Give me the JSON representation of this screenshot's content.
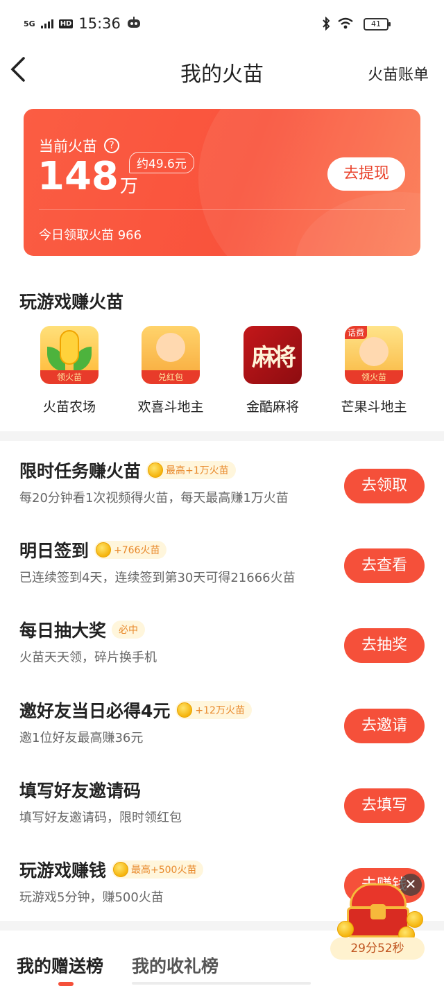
{
  "status_bar": {
    "network": "5G",
    "hd": "HD",
    "time": "15:36",
    "battery": "41"
  },
  "header": {
    "title": "我的火苗",
    "right_link": "火苗账单"
  },
  "balance": {
    "label": "当前火苗",
    "amount": "148",
    "unit": "万",
    "approx": "约49.6元",
    "withdraw": "去提现",
    "today": "今日领取火苗 966"
  },
  "games_section": {
    "title": "玩游戏赚火苗",
    "games": [
      {
        "name": "火苗农场",
        "tag": "领火苗"
      },
      {
        "name": "欢喜斗地主",
        "tag": "兑红包"
      },
      {
        "name": "金酷麻将",
        "icon_text": "麻将"
      },
      {
        "name": "芒果斗地主",
        "tag": "领火苗",
        "corner": "话费"
      }
    ]
  },
  "tasks": [
    {
      "title": "限时任务赚火苗",
      "badge": "最高+1万火苗",
      "coin": true,
      "desc": "每20分钟看1次视频得火苗，每天最高赚1万火苗",
      "button": "去领取"
    },
    {
      "title": "明日签到",
      "badge": "+766火苗",
      "coin": true,
      "desc": "已连续签到4天，连续签到第30天可得21666火苗",
      "button": "去查看"
    },
    {
      "title": "每日抽大奖",
      "badge": "必中",
      "coin": false,
      "desc": "火苗天天领，碎片换手机",
      "button": "去抽奖"
    },
    {
      "title": "邀好友当日必得4元",
      "badge": "+12万火苗",
      "coin": true,
      "desc": "邀1位好友最高赚36元",
      "button": "去邀请"
    },
    {
      "title": "填写好友邀请码",
      "badge": "",
      "coin": false,
      "desc": "填写好友邀请码，限时领红包",
      "button": "去填写"
    },
    {
      "title": "玩游戏赚钱",
      "badge": "最高+500火苗",
      "coin": true,
      "desc": "玩游戏5分钟，赚500火苗",
      "button": "去赚钱"
    }
  ],
  "rank_tabs": {
    "active": "我的赠送榜",
    "inactive": "我的收礼榜"
  },
  "floating": {
    "timer": "29分52秒",
    "close": "✕"
  },
  "colors": {
    "accent": "#f5503a",
    "badge_bg": "#fff6dc",
    "badge_text": "#e8882a"
  }
}
